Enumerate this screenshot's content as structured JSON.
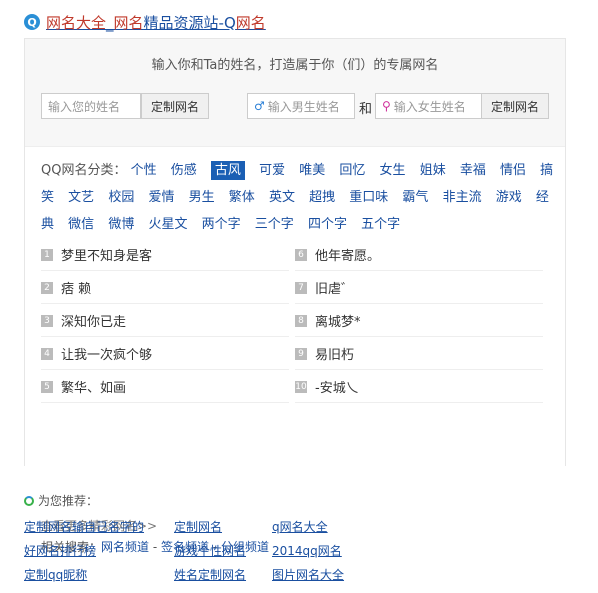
{
  "header": {
    "title_red1": "网名大全",
    "title_mid": "_",
    "title_red2": "网名",
    "title_rest": "精品资源站-Q",
    "title_red3": "网名",
    "logo": "Q"
  },
  "generator": {
    "subtitle": "输入你和Ta的姓名，打造属于你（们）的专属网名",
    "name_placeholder": "输入您的姓名",
    "custom_button": "定制网名",
    "male_placeholder": "输入男生姓名",
    "and": "和",
    "female_placeholder": "输入女生姓名",
    "custom_button2": "定制网名",
    "male_symbol": "♂",
    "female_symbol": "⚲"
  },
  "categories": {
    "label": "QQ网名分类：",
    "items": [
      "个性",
      "伤感",
      "古风",
      "可爱",
      "唯美",
      "回忆",
      "女生",
      "姐妹",
      "幸福",
      "情侣",
      "搞笑",
      "文艺",
      "校园",
      "爱情",
      "男生",
      "繁体",
      "英文",
      "超拽",
      "重口味",
      "霸气",
      "非主流",
      "游戏",
      "经典",
      "微信",
      "微博",
      "火星文",
      "两个字",
      "三个字",
      "四个字",
      "五个字"
    ],
    "active": "古风"
  },
  "names": [
    {
      "num": "1",
      "text": "梦里不知身是客"
    },
    {
      "num": "6",
      "text": "他年寄愿。"
    },
    {
      "num": "2",
      "text": "痞 赖"
    },
    {
      "num": "7",
      "text": "旧虐゛"
    },
    {
      "num": "3",
      "text": "深知你已走"
    },
    {
      "num": "8",
      "text": "离城梦*"
    },
    {
      "num": "4",
      "text": "让我一次疯个够"
    },
    {
      "num": "9",
      "text": "易旧朽"
    },
    {
      "num": "5",
      "text": "繁华、如画"
    },
    {
      "num": "10",
      "text": "-安城乀"
    }
  ],
  "more": "查看更多精彩网名>>",
  "related": {
    "label": "相关搜索：",
    "l1": "网名频道",
    "sep": " - ",
    "l2": "签名频道",
    "l3": "分组频道"
  },
  "recommend": {
    "title": "为您推荐：",
    "links": [
      "定制网名输自己名字的",
      "定制网名",
      "q网名大全",
      "好网名排行榜",
      "游戏个性网名",
      "2014qq网名",
      "定制qq昵称",
      "姓名定制网名",
      "图片网名大全"
    ]
  }
}
